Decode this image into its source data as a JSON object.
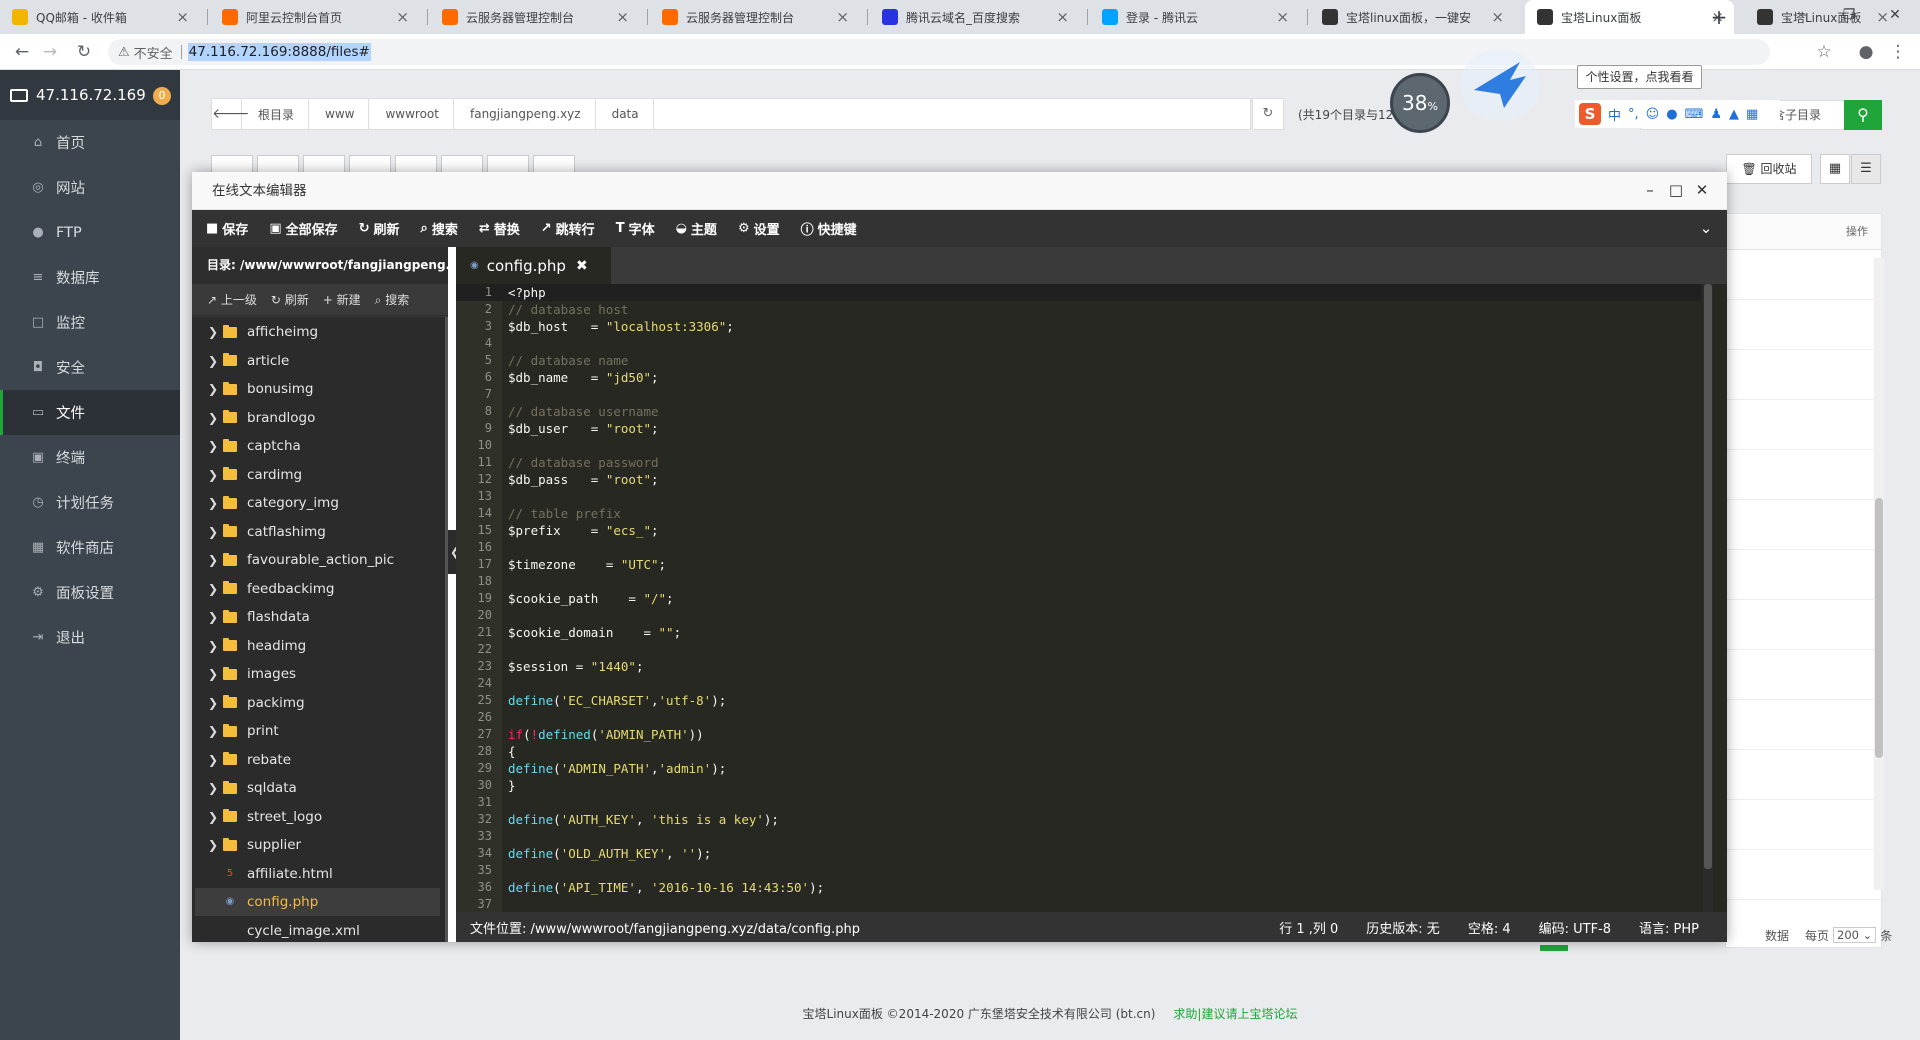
{
  "browser": {
    "tabs": [
      {
        "title": "QQ邮箱 - 收件箱",
        "icon": "qq-mail-icon",
        "color": "#f2b500"
      },
      {
        "title": "阿里云控制台首页",
        "icon": "aliyun-icon",
        "color": "#ff6a00"
      },
      {
        "title": "云服务器管理控制台",
        "icon": "aliyun-icon",
        "color": "#ff6a00"
      },
      {
        "title": "云服务器管理控制台",
        "icon": "aliyun-icon",
        "color": "#ff6a00"
      },
      {
        "title": "腾讯云域名_百度搜索",
        "icon": "baidu-icon",
        "color": "#2932e1"
      },
      {
        "title": "登录 - 腾讯云",
        "icon": "tencent-cloud-icon",
        "color": "#00a4ff"
      },
      {
        "title": "宝塔linux面板，一键安",
        "icon": "bt-icon",
        "color": "#333333"
      },
      {
        "title": "宝塔Linux面板",
        "icon": "bt-icon",
        "color": "#333333",
        "active": true
      },
      {
        "title": "宝塔Linux面板",
        "icon": "bt-icon",
        "color": "#333333"
      }
    ],
    "insecure_label": "不安全",
    "url": "47.116.72.169:8888/files#"
  },
  "sidebar": {
    "server_ip": "47.116.72.169",
    "badge": "0",
    "items": [
      {
        "label": "首页",
        "icon": "home-icon"
      },
      {
        "label": "网站",
        "icon": "globe-icon"
      },
      {
        "label": "FTP",
        "icon": "ftp-icon"
      },
      {
        "label": "数据库",
        "icon": "database-icon"
      },
      {
        "label": "监控",
        "icon": "monitor-icon"
      },
      {
        "label": "安全",
        "icon": "shield-icon"
      },
      {
        "label": "文件",
        "icon": "folder-icon",
        "active": true
      },
      {
        "label": "终端",
        "icon": "terminal-icon"
      },
      {
        "label": "计划任务",
        "icon": "schedule-icon"
      },
      {
        "label": "软件商店",
        "icon": "store-icon"
      },
      {
        "label": "面板设置",
        "icon": "gear-icon"
      },
      {
        "label": "退出",
        "icon": "logout-icon"
      }
    ]
  },
  "filebrowser": {
    "breadcrumb": [
      "根目录",
      "www",
      "wwwroot",
      "fangjiangpeng.xyz",
      "data"
    ],
    "count_info": "(共19个目录与12",
    "subdir_search": "含子目录",
    "recycle_label": "回收站",
    "table_header_action": "操作",
    "pager_prefix": "每页",
    "pager_value": "200",
    "pager_suffix": "条",
    "pager_data": "数据"
  },
  "widgets": {
    "perf_percent": "38",
    "perf_unit": "%",
    "tooltip": "个性设置，点我看看",
    "ime_lang": "中"
  },
  "editor": {
    "title": "在线文本编辑器",
    "toolbar": [
      {
        "label": "保存",
        "icon": "save-icon"
      },
      {
        "label": "全部保存",
        "icon": "save-all-icon"
      },
      {
        "label": "刷新",
        "icon": "refresh-icon"
      },
      {
        "label": "搜索",
        "icon": "search-icon"
      },
      {
        "label": "替换",
        "icon": "replace-icon"
      },
      {
        "label": "跳转行",
        "icon": "goto-line-icon"
      },
      {
        "label": "字体",
        "icon": "font-icon"
      },
      {
        "label": "主题",
        "icon": "theme-icon"
      },
      {
        "label": "设置",
        "icon": "gear-icon"
      },
      {
        "label": "快捷键",
        "icon": "info-icon"
      }
    ],
    "directory": "目录: /www/wwwroot/fangjiangpeng.x...",
    "file_actions": [
      "上一级",
      "刷新",
      "新建",
      "搜索"
    ],
    "tree": [
      {
        "name": "afficheimg",
        "type": "folder"
      },
      {
        "name": "article",
        "type": "folder"
      },
      {
        "name": "bonusimg",
        "type": "folder"
      },
      {
        "name": "brandlogo",
        "type": "folder"
      },
      {
        "name": "captcha",
        "type": "folder"
      },
      {
        "name": "cardimg",
        "type": "folder"
      },
      {
        "name": "category_img",
        "type": "folder"
      },
      {
        "name": "catflashimg",
        "type": "folder"
      },
      {
        "name": "favourable_action_pic",
        "type": "folder"
      },
      {
        "name": "feedbackimg",
        "type": "folder"
      },
      {
        "name": "flashdata",
        "type": "folder"
      },
      {
        "name": "headimg",
        "type": "folder"
      },
      {
        "name": "images",
        "type": "folder"
      },
      {
        "name": "packimg",
        "type": "folder"
      },
      {
        "name": "print",
        "type": "folder"
      },
      {
        "name": "rebate",
        "type": "folder"
      },
      {
        "name": "sqldata",
        "type": "folder"
      },
      {
        "name": "street_logo",
        "type": "folder"
      },
      {
        "name": "supplier",
        "type": "folder"
      },
      {
        "name": "affiliate.html",
        "type": "html"
      },
      {
        "name": "config.php",
        "type": "php",
        "selected": true
      },
      {
        "name": "cycle_image.xml",
        "type": "xml"
      }
    ],
    "open_tab": "config.php",
    "code_lines": [
      [
        [
          "var",
          "<?php"
        ]
      ],
      [
        [
          "cm",
          "// database host"
        ]
      ],
      [
        [
          "var",
          "$db_host   = "
        ],
        [
          "str",
          "\"localhost:3306\""
        ],
        [
          "var",
          ";"
        ]
      ],
      [],
      [
        [
          "cm",
          "// database name"
        ]
      ],
      [
        [
          "var",
          "$db_name   = "
        ],
        [
          "str",
          "\"jd50\""
        ],
        [
          "var",
          ";"
        ]
      ],
      [],
      [
        [
          "cm",
          "// database username"
        ]
      ],
      [
        [
          "var",
          "$db_user   = "
        ],
        [
          "str",
          "\"root\""
        ],
        [
          "var",
          ";"
        ]
      ],
      [],
      [
        [
          "cm",
          "// database password"
        ]
      ],
      [
        [
          "var",
          "$db_pass   = "
        ],
        [
          "str",
          "\"root\""
        ],
        [
          "var",
          ";"
        ]
      ],
      [],
      [
        [
          "cm",
          "// table prefix"
        ]
      ],
      [
        [
          "var",
          "$prefix    = "
        ],
        [
          "str",
          "\"ecs_\""
        ],
        [
          "var",
          ";"
        ]
      ],
      [],
      [
        [
          "var",
          "$timezone    = "
        ],
        [
          "str",
          "\"UTC\""
        ],
        [
          "var",
          ";"
        ]
      ],
      [],
      [
        [
          "var",
          "$cookie_path    = "
        ],
        [
          "str",
          "\"/\""
        ],
        [
          "var",
          ";"
        ]
      ],
      [],
      [
        [
          "var",
          "$cookie_domain    = "
        ],
        [
          "str",
          "\"\""
        ],
        [
          "var",
          ";"
        ]
      ],
      [],
      [
        [
          "var",
          "$session = "
        ],
        [
          "str",
          "\"1440\""
        ],
        [
          "var",
          ";"
        ]
      ],
      [],
      [
        [
          "fn",
          "define"
        ],
        [
          "var",
          "("
        ],
        [
          "str",
          "'EC_CHARSET'"
        ],
        [
          "var",
          ","
        ],
        [
          "str",
          "'utf-8'"
        ],
        [
          "var",
          ");"
        ]
      ],
      [],
      [
        [
          "kw",
          "if"
        ],
        [
          "var",
          "("
        ],
        [
          "kw",
          "!"
        ],
        [
          "fn",
          "defined"
        ],
        [
          "var",
          "("
        ],
        [
          "str",
          "'ADMIN_PATH'"
        ],
        [
          "var",
          "))"
        ]
      ],
      [
        [
          "var",
          "{"
        ]
      ],
      [
        [
          "fn",
          "define"
        ],
        [
          "var",
          "("
        ],
        [
          "str",
          "'ADMIN_PATH'"
        ],
        [
          "var",
          ","
        ],
        [
          "str",
          "'admin'"
        ],
        [
          "var",
          ");"
        ]
      ],
      [
        [
          "var",
          "}"
        ]
      ],
      [],
      [
        [
          "fn",
          "define"
        ],
        [
          "var",
          "("
        ],
        [
          "str",
          "'AUTH_KEY'"
        ],
        [
          "var",
          ", "
        ],
        [
          "str",
          "'this is a key'"
        ],
        [
          "var",
          ");"
        ]
      ],
      [],
      [
        [
          "fn",
          "define"
        ],
        [
          "var",
          "("
        ],
        [
          "str",
          "'OLD_AUTH_KEY'"
        ],
        [
          "var",
          ", "
        ],
        [
          "str",
          "''"
        ],
        [
          "var",
          ");"
        ]
      ],
      [],
      [
        [
          "fn",
          "define"
        ],
        [
          "var",
          "("
        ],
        [
          "str",
          "'API_TIME'"
        ],
        [
          "var",
          ", "
        ],
        [
          "str",
          "'2016-10-16 14:43:50'"
        ],
        [
          "var",
          ");"
        ]
      ],
      []
    ],
    "status": {
      "path": "文件位置: /www/wwwroot/fangjiangpeng.xyz/data/config.php",
      "cursor": "行 1 ,列 0",
      "history": "历史版本: 无",
      "indent": "空格: 4",
      "encoding": "编码: UTF-8",
      "language": "语言: PHP"
    }
  },
  "footer": {
    "copyright": "宝塔Linux面板 ©2014-2020 广东堡塔安全技术有限公司 (bt.cn)",
    "link": "求助|建议请上宝塔论坛"
  }
}
